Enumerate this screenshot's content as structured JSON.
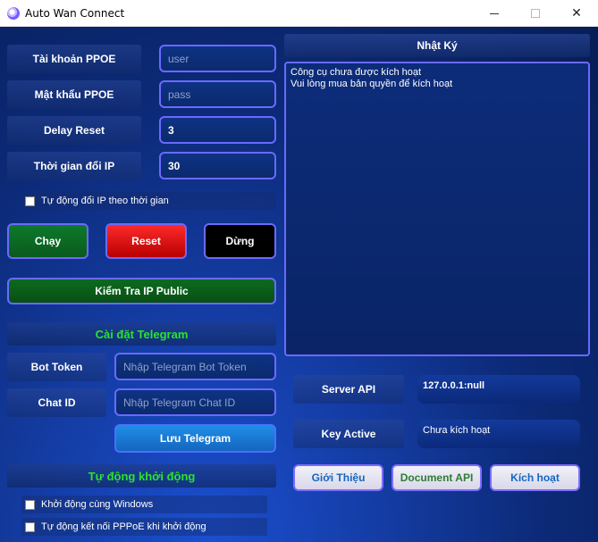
{
  "window": {
    "title": "Auto Wan Connect",
    "minimize_label": "",
    "maximize_label": "",
    "close_label": "✕"
  },
  "ppoe": {
    "account_label": "Tài khoản PPOE",
    "account_placeholder": "user",
    "password_label": "Mật khẩu PPOE",
    "password_placeholder": "pass",
    "delay_label": "Delay Reset",
    "delay_value": "3",
    "interval_label": "Thời gian đổi IP",
    "interval_value": "30",
    "auto_change_label": "Tự động đổi IP theo thời gian"
  },
  "actions": {
    "run": "Chạy",
    "reset": "Reset",
    "stop": "Dừng",
    "check_ip": "Kiểm Tra IP Public"
  },
  "telegram": {
    "section_title": "Cài đặt Telegram",
    "bot_token_label": "Bot Token",
    "bot_token_placeholder": "Nhập Telegram Bot Token",
    "chat_id_label": "Chat ID",
    "chat_id_placeholder": "Nhập Telegram Chat ID",
    "save_button": "Lưu Telegram"
  },
  "startup": {
    "section_title": "Tự động khởi động",
    "start_with_windows": "Khởi động cùng Windows",
    "auto_connect": "Tự động kết nối PPPoE khi khởi động"
  },
  "log": {
    "title": "Nhật Ký",
    "lines": [
      "Công cụ chưa được kích hoạt",
      "Vui lòng mua bản quyền để kích hoạt"
    ]
  },
  "server": {
    "api_label": "Server API",
    "api_value": "127.0.0.1:null",
    "key_label": "Key Active",
    "key_value": "Chưa kích hoạt"
  },
  "bottom_buttons": {
    "intro": "Giới Thiệu",
    "docs": "Document API",
    "activate": "Kích hoạt"
  },
  "colors": {
    "accent_border": "#6a6aff",
    "section_title_green": "#28e42a",
    "button_blue_text": "#1565c0"
  }
}
